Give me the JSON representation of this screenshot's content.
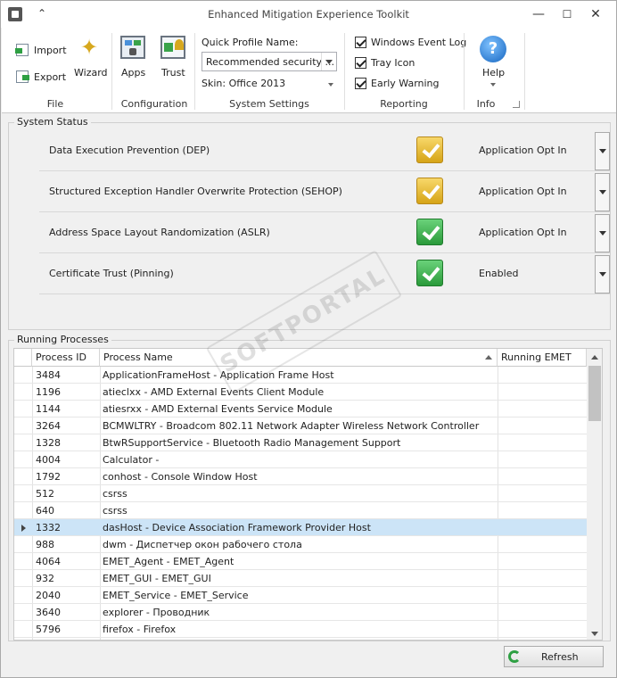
{
  "window": {
    "title": "Enhanced Mitigation Experience Toolkit",
    "minimize": "—",
    "maximize": "☐",
    "close": "✕"
  },
  "ribbon": {
    "file": {
      "import": "Import",
      "export": "Export",
      "wizard": "Wizard",
      "group": "File"
    },
    "configuration": {
      "apps": "Apps",
      "trust": "Trust",
      "group": "Configuration"
    },
    "system_settings": {
      "quick_profile_label": "Quick Profile Name:",
      "quick_profile_value": "Recommended security ...",
      "skin": "Skin: Office 2013",
      "group": "System Settings"
    },
    "reporting": {
      "windows_event_log": "Windows Event Log",
      "tray_icon": "Tray Icon",
      "early_warning": "Early Warning",
      "group": "Reporting"
    },
    "info": {
      "help": "Help",
      "group": "Info"
    }
  },
  "system_status": {
    "title": "System Status",
    "rows": [
      {
        "label": "Data Execution Prevention (DEP)",
        "value": "Application Opt In",
        "state": "yellow"
      },
      {
        "label": "Structured Exception Handler Overwrite Protection (SEHOP)",
        "value": "Application Opt In",
        "state": "yellow"
      },
      {
        "label": "Address Space Layout Randomization (ASLR)",
        "value": "Application Opt In",
        "state": "green"
      },
      {
        "label": "Certificate Trust (Pinning)",
        "value": "Enabled",
        "state": "green"
      }
    ]
  },
  "running_processes": {
    "title": "Running Processes",
    "columns": [
      "Process ID",
      "Process Name",
      "Running EMET"
    ],
    "selected_index": 9,
    "rows": [
      [
        "3484",
        "ApplicationFrameHost - Application Frame Host",
        ""
      ],
      [
        "1196",
        "atieclxx - AMD External Events Client Module",
        ""
      ],
      [
        "1144",
        "atiesrxx - AMD External Events Service Module",
        ""
      ],
      [
        "3264",
        "BCMWLTRY - Broadcom 802.11 Network Adapter Wireless Network Controller",
        ""
      ],
      [
        "1328",
        "BtwRSupportService - Bluetooth Radio Management Support",
        ""
      ],
      [
        "4004",
        "Calculator -",
        ""
      ],
      [
        "1792",
        "conhost - Console Window Host",
        ""
      ],
      [
        "512",
        "csrss",
        ""
      ],
      [
        "640",
        "csrss",
        ""
      ],
      [
        "1332",
        "dasHost - Device Association Framework Provider Host",
        ""
      ],
      [
        "988",
        "dwm - Диспетчер окон рабочего стола",
        ""
      ],
      [
        "4064",
        "EMET_Agent - EMET_Agent",
        ""
      ],
      [
        "932",
        "EMET_GUI - EMET_GUI",
        ""
      ],
      [
        "2040",
        "EMET_Service - EMET_Service",
        ""
      ],
      [
        "3640",
        "explorer - Проводник",
        ""
      ],
      [
        "5796",
        "firefox - Firefox",
        ""
      ]
    ]
  },
  "refresh_button": "Refresh",
  "watermark": "SOFTPORTAL www.softportal.com"
}
